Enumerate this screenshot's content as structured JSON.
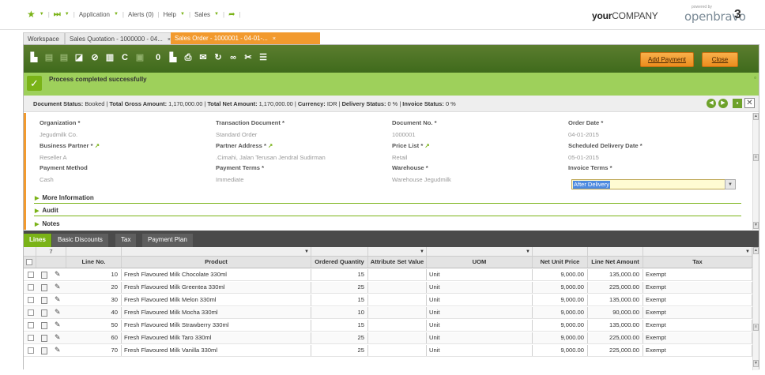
{
  "topnav": {
    "application": "Application",
    "alerts": "Alerts (0)",
    "help": "Help",
    "sales": "Sales"
  },
  "logo": {
    "your": "your",
    "company": "COMPANY",
    "powered_by": "powered by",
    "openbravo": "openbravo",
    "three": "3"
  },
  "tabs": [
    {
      "label": "Workspace"
    },
    {
      "label": "Sales Quotation - 1000000 - 04...",
      "close": "×"
    },
    {
      "label": "Sales Order - 1000001 - 04-01-...",
      "close": "×"
    }
  ],
  "toolbar": {
    "add_payment": "Add Payment",
    "close": "Close"
  },
  "message": {
    "text": "Process completed successfully"
  },
  "status": {
    "doc_status_label": "Document Status:",
    "doc_status": "Booked",
    "gross_label": "Total Gross Amount:",
    "gross": "1,170,000.00",
    "net_label": "Total Net Amount:",
    "net": "1,170,000.00",
    "currency_label": "Currency:",
    "currency": "IDR",
    "delivery_label": "Delivery Status:",
    "delivery": "0 %",
    "invoice_label": "Invoice Status:",
    "invoice": "0 %"
  },
  "form": {
    "organization": {
      "label": "Organization",
      "value": "Jegudmilk Co."
    },
    "transaction_document": {
      "label": "Transaction Document",
      "value": "Standard Order"
    },
    "document_no": {
      "label": "Document No.",
      "value": "1000001"
    },
    "order_date": {
      "label": "Order Date",
      "value": "04-01-2015"
    },
    "business_partner": {
      "label": "Business Partner",
      "value": "Reseller A"
    },
    "partner_address": {
      "label": "Partner Address",
      "value": ".Cimahi, Jalan Terusan Jendral Sudirman"
    },
    "price_list": {
      "label": "Price List",
      "value": "Retail"
    },
    "scheduled_delivery": {
      "label": "Scheduled Delivery Date",
      "value": "05-01-2015"
    },
    "payment_method": {
      "label": "Payment Method",
      "value": "Cash"
    },
    "payment_terms": {
      "label": "Payment Terms",
      "value": "Immediate"
    },
    "warehouse": {
      "label": "Warehouse",
      "value": "Warehouse Jegudmilk"
    },
    "invoice_terms": {
      "label": "Invoice Terms",
      "value": "After Delivery"
    }
  },
  "sections": [
    "More Information",
    "Audit",
    "Notes"
  ],
  "grid_tabs": [
    "Lines",
    "Basic Discounts",
    "Tax",
    "Payment Plan"
  ],
  "grid": {
    "filter_count": "7",
    "columns": [
      "Line No.",
      "Product",
      "Ordered Quantity",
      "Attribute Set Value",
      "UOM",
      "Net Unit Price",
      "Line Net Amount",
      "Tax"
    ],
    "rows": [
      {
        "line": "10",
        "product": "Fresh Flavoured Milk Chocolate 330ml",
        "qty": "15",
        "attr": "",
        "uom": "Unit",
        "price": "9,000.00",
        "amount": "135,000.00",
        "tax": "Exempt"
      },
      {
        "line": "20",
        "product": "Fresh Flavoured Milk Greentea 330ml",
        "qty": "25",
        "attr": "",
        "uom": "Unit",
        "price": "9,000.00",
        "amount": "225,000.00",
        "tax": "Exempt"
      },
      {
        "line": "30",
        "product": "Fresh Flavoured Milk Melon 330ml",
        "qty": "15",
        "attr": "",
        "uom": "Unit",
        "price": "9,000.00",
        "amount": "135,000.00",
        "tax": "Exempt"
      },
      {
        "line": "40",
        "product": "Fresh Flavoured Milk Mocha 330ml",
        "qty": "10",
        "attr": "",
        "uom": "Unit",
        "price": "9,000.00",
        "amount": "90,000.00",
        "tax": "Exempt"
      },
      {
        "line": "50",
        "product": "Fresh Flavoured Milk Strawberry 330ml",
        "qty": "15",
        "attr": "",
        "uom": "Unit",
        "price": "9,000.00",
        "amount": "135,000.00",
        "tax": "Exempt"
      },
      {
        "line": "60",
        "product": "Fresh Flavoured Milk Taro 330ml",
        "qty": "25",
        "attr": "",
        "uom": "Unit",
        "price": "9,000.00",
        "amount": "225,000.00",
        "tax": "Exempt"
      },
      {
        "line": "70",
        "product": "Fresh Flavoured Milk Vanilla 330ml",
        "qty": "25",
        "attr": "",
        "uom": "Unit",
        "price": "9,000.00",
        "amount": "225,000.00",
        "tax": "Exempt"
      }
    ]
  },
  "colors": {
    "accent_green": "#7ab317",
    "toolbar_green": "#4a7523",
    "orange": "#f29a2e",
    "message_green": "#9ed05b"
  }
}
